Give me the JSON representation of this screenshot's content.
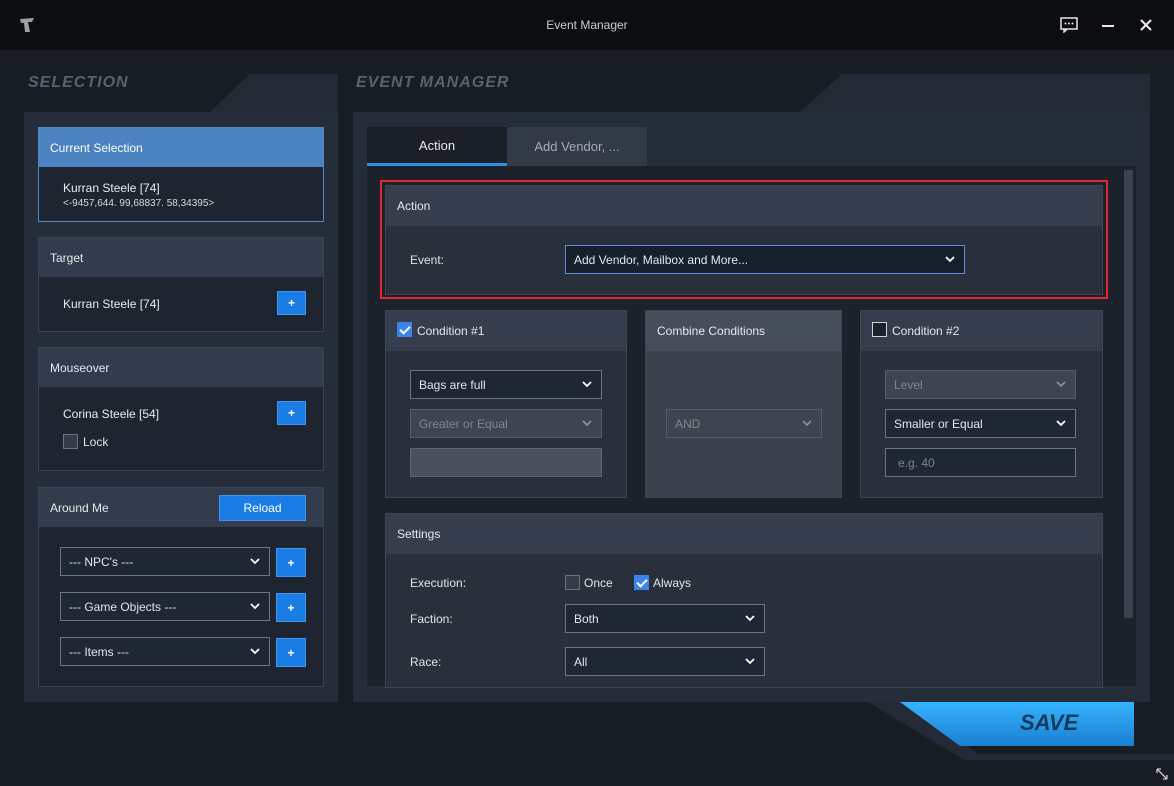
{
  "window": {
    "title": "Event Manager"
  },
  "selection": {
    "heading": "SELECTION",
    "current": {
      "header": "Current Selection",
      "name": "Kurran Steele [74]",
      "coords": "<-9457,644. 99,68837. 58,34395>"
    },
    "target": {
      "header": "Target",
      "name": "Kurran Steele [74]",
      "add_label": "+"
    },
    "mouseover": {
      "header": "Mouseover",
      "name": "Corina Steele [54]",
      "add_label": "+",
      "lock_label": "Lock"
    },
    "around_me": {
      "header": "Around Me",
      "reload_label": "Reload",
      "npcs": "--- NPC's ---",
      "game_objects": "--- Game Objects ---",
      "items": "--- Items ---",
      "add_label": "+"
    }
  },
  "event_manager": {
    "heading": "EVENT MANAGER",
    "tabs": [
      {
        "label": "Action",
        "active": true
      },
      {
        "label": "Add Vendor, ...",
        "active": false
      }
    ],
    "action": {
      "header": "Action",
      "event_label": "Event:",
      "event_value": "Add Vendor, Mailbox and More..."
    },
    "condition1": {
      "header": "Condition #1",
      "checked": true,
      "type": "Bags are full",
      "comparator": "Greater or Equal",
      "value": ""
    },
    "combine": {
      "header": "Combine Conditions",
      "operator": "AND"
    },
    "condition2": {
      "header": "Condition #2",
      "checked": false,
      "type": "Level",
      "comparator": "Smaller or Equal",
      "placeholder": "e.g. 40"
    },
    "settings": {
      "header": "Settings",
      "execution_label": "Execution:",
      "once_label": "Once",
      "once_checked": false,
      "always_label": "Always",
      "always_checked": true,
      "faction_label": "Faction:",
      "faction_value": "Both",
      "race_label": "Race:",
      "race_value": "All"
    }
  },
  "footer": {
    "save_label": "SAVE"
  },
  "colors": {
    "accent": "#1a7de6",
    "highlight_border": "#e0282e",
    "selection_header": "#4a83c0"
  }
}
